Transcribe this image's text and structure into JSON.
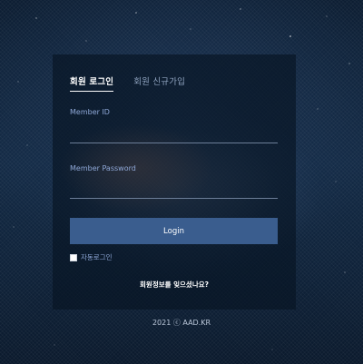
{
  "tabs": [
    {
      "label": "회원 로그인",
      "active": true
    },
    {
      "label": "회원 신규가입",
      "active": false
    }
  ],
  "form": {
    "member_id_label": "Member ID",
    "member_id_value": "",
    "member_password_label": "Member Password",
    "member_password_value": "",
    "login_button_label": "Login",
    "auto_login_label": "자동로그인",
    "auto_login_checked": false,
    "forgot_link_label": "회원정보를 잊으셨나요?"
  },
  "footer": {
    "copyright": "2021 ⓒ AAD.KR"
  },
  "colors": {
    "accent_button": "#3a5d8e",
    "label_blue": "#8fa8d8",
    "panel_bg": "rgba(8,20,36,0.68)"
  }
}
